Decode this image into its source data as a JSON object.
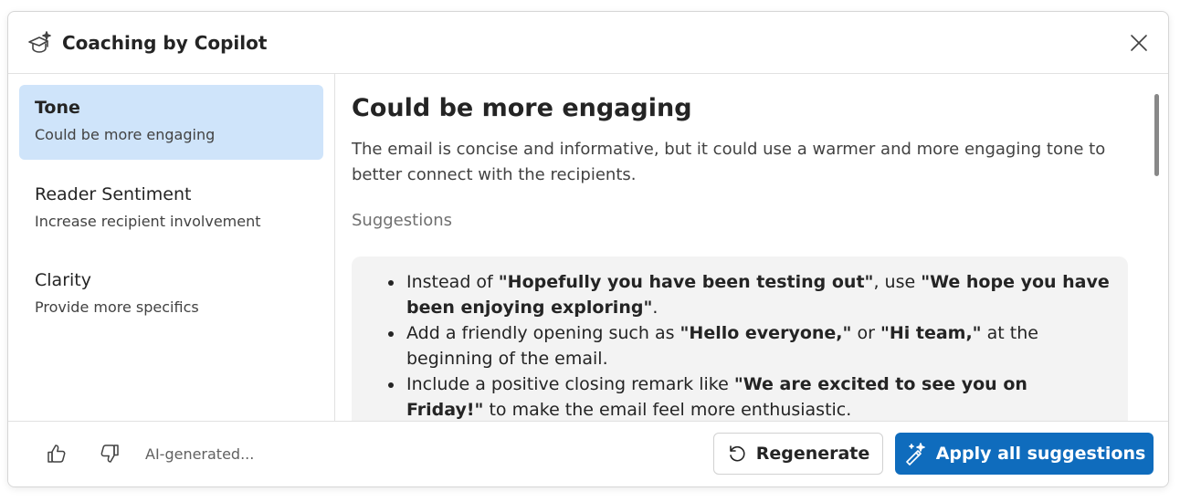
{
  "dialog": {
    "title": "Coaching by Copilot"
  },
  "sidebar": {
    "items": [
      {
        "title": "Tone",
        "subtitle": "Could be more engaging",
        "active": true
      },
      {
        "title": "Reader Sentiment",
        "subtitle": "Increase recipient involvement",
        "active": false
      },
      {
        "title": "Clarity",
        "subtitle": "Provide more specifics",
        "active": false
      }
    ]
  },
  "main": {
    "heading": "Could be more engaging",
    "description": "The email is concise and informative, but it could use a warmer and more engaging tone to better connect with the recipients.",
    "suggestions_heading": "Suggestions",
    "suggestions": [
      {
        "pre": "Instead of ",
        "b1": "\"Hopefully you have been testing out\"",
        "mid": ", use ",
        "b2": "\"We hope you have been enjoying exploring\"",
        "post": "."
      },
      {
        "pre": "Add a friendly opening such as ",
        "b1": "\"Hello everyone,\"",
        "mid": " or ",
        "b2": "\"Hi team,\"",
        "post": " at the beginning of the email."
      },
      {
        "pre": "Include a positive closing remark like ",
        "b1": "\"We are excited to see you on Friday!\"",
        "mid": " to make the email feel more enthusiastic.",
        "b2": "",
        "post": ""
      }
    ]
  },
  "footer": {
    "ai_label": "AI-generated...",
    "regenerate_label": "Regenerate",
    "apply_label": "Apply all suggestions"
  },
  "icons": {
    "header": "graduation-cap-sparkle-icon",
    "close": "close-icon",
    "like": "thumbs-up-icon",
    "dislike": "thumbs-down-icon",
    "regenerate": "refresh-icon",
    "apply": "magic-wand-icon"
  },
  "colors": {
    "accent": "#0f6cbd",
    "selected_bg": "#cfe4fa",
    "suggestion_bg": "#f3f3f3"
  }
}
